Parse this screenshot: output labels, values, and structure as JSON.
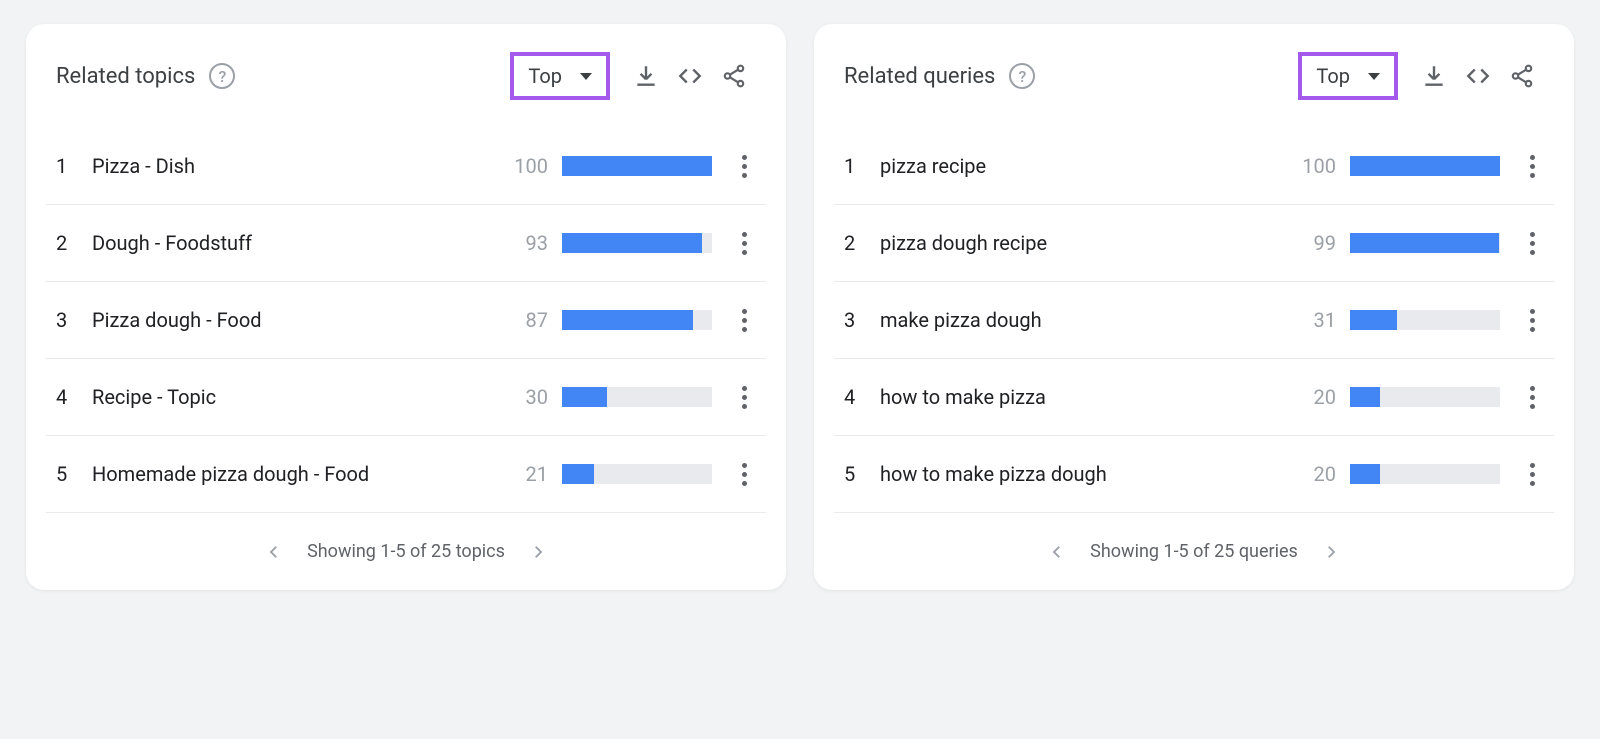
{
  "topics": {
    "title": "Related topics",
    "sort_label": "Top",
    "pager_text": "Showing 1-5 of 25 topics",
    "items": [
      {
        "rank": "1",
        "label": "Pizza - Dish",
        "value": "100",
        "pct": 100
      },
      {
        "rank": "2",
        "label": "Dough - Foodstuff",
        "value": "93",
        "pct": 93
      },
      {
        "rank": "3",
        "label": "Pizza dough - Food",
        "value": "87",
        "pct": 87
      },
      {
        "rank": "4",
        "label": "Recipe - Topic",
        "value": "30",
        "pct": 30
      },
      {
        "rank": "5",
        "label": "Homemade pizza dough - Food",
        "value": "21",
        "pct": 21
      }
    ]
  },
  "queries": {
    "title": "Related queries",
    "sort_label": "Top",
    "pager_text": "Showing 1-5 of 25 queries",
    "items": [
      {
        "rank": "1",
        "label": "pizza recipe",
        "value": "100",
        "pct": 100
      },
      {
        "rank": "2",
        "label": "pizza dough recipe",
        "value": "99",
        "pct": 99
      },
      {
        "rank": "3",
        "label": "make pizza dough",
        "value": "31",
        "pct": 31
      },
      {
        "rank": "4",
        "label": "how to make pizza",
        "value": "20",
        "pct": 20
      },
      {
        "rank": "5",
        "label": "how to make pizza dough",
        "value": "20",
        "pct": 20
      }
    ]
  }
}
